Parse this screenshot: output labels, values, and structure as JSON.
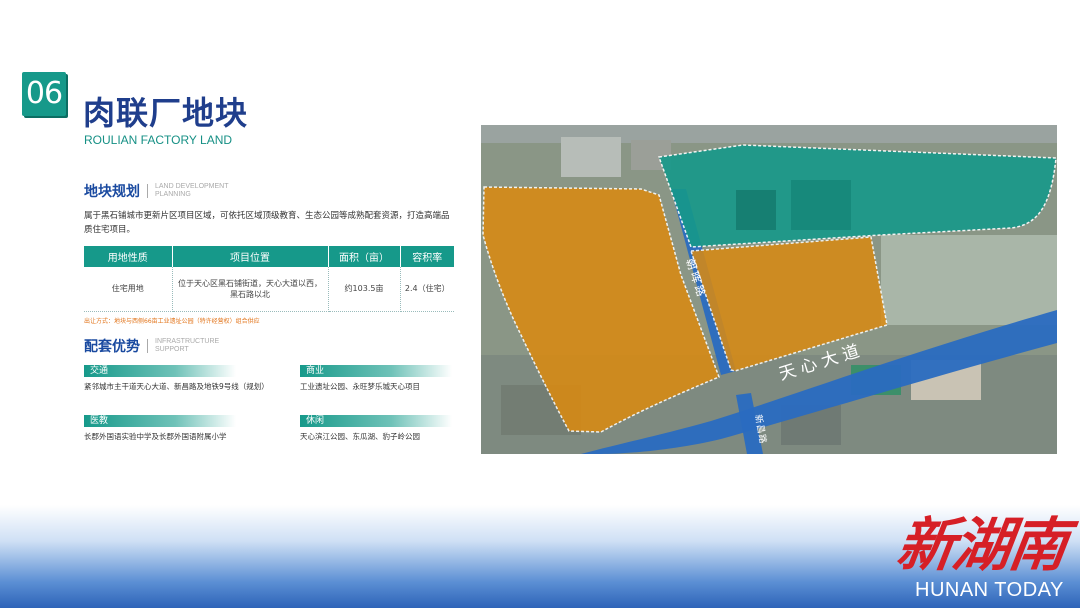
{
  "header": {
    "number": "06",
    "title_cn": "肉联厂地块",
    "title_en": "ROULIAN FACTORY LAND"
  },
  "planning": {
    "title_cn": "地块规划",
    "title_en": "LAND DEVELOPMENT PLANNING",
    "description": "属于黑石铺城市更新片区项目区域，可依托区域顶级教育、生态公园等成熟配套资源，打造高端品质住宅项目。"
  },
  "table": {
    "headers": [
      "用地性质",
      "项目位置",
      "面积（亩）",
      "容积率"
    ],
    "rows": [
      [
        "住宅用地",
        "位于天心区黑石铺街道，天心大道以西，黑石路以北",
        "约103.5亩",
        "2.4（住宅）"
      ]
    ],
    "note": "出让方式：地块与西侧66亩工业遗址公园（特许经营权）组合供应"
  },
  "facilities": {
    "title_cn": "配套优势",
    "title_en": "INFRASTRUCTURE SUPPORT",
    "items": [
      {
        "label": "交通",
        "text": "紧邻城市主干道天心大道、新昌路及地铁9号线（规划）"
      },
      {
        "label": "商业",
        "text": "工业遗址公园、永旺梦乐城天心项目"
      },
      {
        "label": "医教",
        "text": "长郡外国语实验中学及长郡外国语附属小学"
      },
      {
        "label": "休闲",
        "text": "天心滨江公园、东瓜湖、豹子岭公园"
      }
    ]
  },
  "map": {
    "road_main": "天心大道",
    "road_vertical": "朝晖路",
    "road_small": "新昌路",
    "colors": {
      "orange": "#d98a12",
      "teal": "#16998a",
      "road": "#2a6cc0"
    }
  },
  "logo": {
    "cn": "新湖南",
    "en": "HUNAN TODAY"
  }
}
